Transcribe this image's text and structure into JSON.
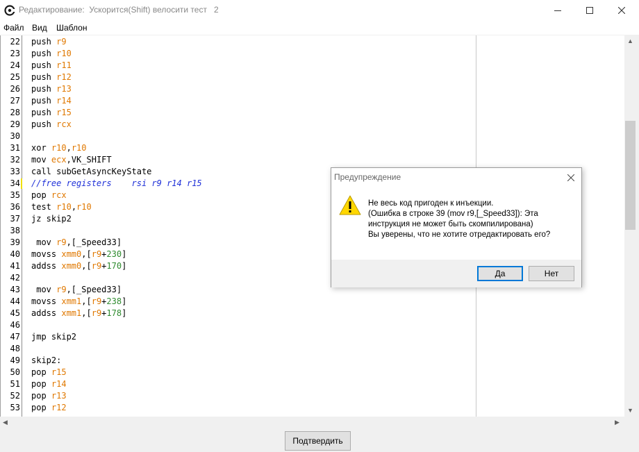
{
  "window": {
    "title": "Редактирование:  Ускорится(Shift) велосити тест   2"
  },
  "menu": [
    "Файл",
    "Вид",
    "Шаблон"
  ],
  "editor": {
    "line_numbers": [
      "22",
      "23",
      "24",
      "25",
      "26",
      "27",
      "28",
      "29",
      "30",
      "31",
      "32",
      "33",
      "34",
      "35",
      "36",
      "37",
      "38",
      "39",
      "40",
      "41",
      "42",
      "43",
      "44",
      "45",
      "46",
      "47",
      "48",
      "49",
      "50",
      "51",
      "52",
      "53"
    ],
    "current_line": "34",
    "colors": {
      "register": "#e07800",
      "number": "#2e8b2e",
      "comment": "#1f30d8"
    },
    "lines": [
      "push r9",
      "push r10",
      "push r11",
      "push r12",
      "push r13",
      "push r14",
      "push r15",
      "push rcx",
      "",
      "xor r10,r10",
      "mov ecx,VK_SHIFT",
      "call subGetAsyncKeyState",
      "//free registers    rsi r9 r14 r15",
      "pop rcx",
      "test r10,r10",
      "jz skip2",
      "",
      " mov r9,[_Speed33]",
      "movss xmm0,[r9+230]",
      "addss xmm0,[r9+170]",
      "",
      " mov r9,[_Speed33]",
      "movss xmm1,[r9+238]",
      "addss xmm1,[r9+178]",
      "",
      "jmp skip2",
      "",
      "skip2:",
      "pop r15",
      "pop r14",
      "pop r13",
      "pop r12"
    ]
  },
  "bottom": {
    "confirm_label": "Подтвердить"
  },
  "dialog": {
    "title": "Предупреждение",
    "icon": "warning-icon",
    "message_lines": [
      "Не весь код пригоден к инъекции.",
      "(Ошибка в строке 39 (mov r9,[_Speed33]): Эта",
      "инструкция не может быть скомпилирована)",
      "Вы уверены, что не хотите отредактировать его?"
    ],
    "yes_label": "Да",
    "no_label": "Нет",
    "focus_color": "#0078d7"
  }
}
